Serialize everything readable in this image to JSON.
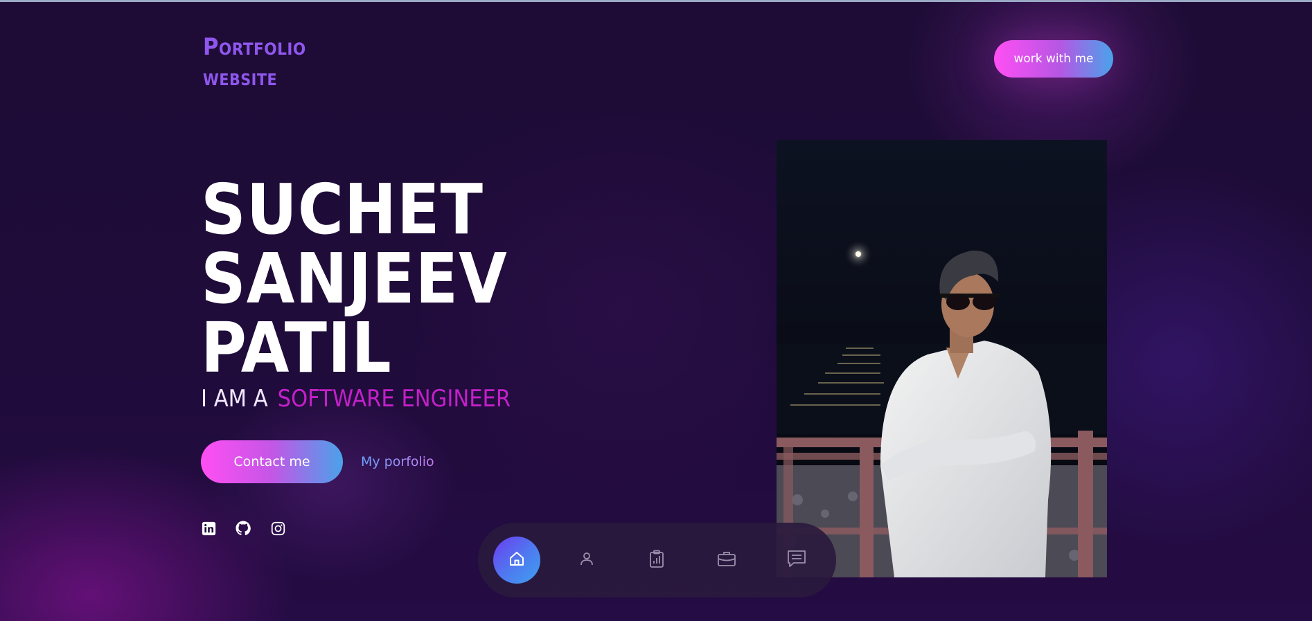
{
  "header": {
    "logo_line1": "Portfolio",
    "logo_line2": "website",
    "cta_label": "work with me"
  },
  "hero": {
    "name_line1": "SUCHET",
    "name_line2": "SANJEEV",
    "name_line3": "PATIL",
    "role_prefix": "I AM A",
    "role_highlight": "SOFTWARE ENGINEER",
    "contact_label": "Contact me",
    "portfolio_label": "My porfolio"
  },
  "socials": [
    {
      "icon": "linkedin-icon"
    },
    {
      "icon": "github-icon"
    },
    {
      "icon": "instagram-icon"
    }
  ],
  "bottom_nav": {
    "active": "home",
    "items": [
      {
        "icon": "home-icon"
      },
      {
        "icon": "user-icon"
      },
      {
        "icon": "clipboard-chart-icon"
      },
      {
        "icon": "briefcase-icon"
      },
      {
        "icon": "message-icon"
      }
    ]
  },
  "colors": {
    "accent_pink": "#ff4ff4",
    "accent_blue": "#4aa2ea",
    "logo_purple": "#8f57ee",
    "role_magenta": "#c420c9",
    "background": "#1e0c36"
  }
}
